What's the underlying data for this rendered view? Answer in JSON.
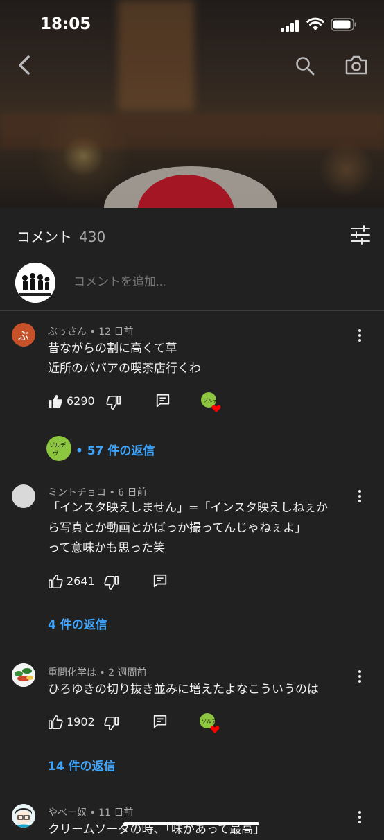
{
  "status": {
    "time": "18:05"
  },
  "comments_header": {
    "title": "コメント",
    "count": "430"
  },
  "add_comment": {
    "placeholder": "コメントを追加..."
  },
  "comments": [
    {
      "author": "ぶぅさん",
      "age": "12 日前",
      "avatar_letter": "ぶ",
      "avatar_color": "#c7522a",
      "lines": [
        "昔ながらの割に高くて草",
        "近所のババアの喫茶店行くわ"
      ],
      "likes": "6290",
      "replies_label": "57 件の返信",
      "replies_prefix": "•"
    },
    {
      "author": "ミントチョコ",
      "age": "6 日前",
      "avatar_color": "#d9d9d9",
      "lines": [
        "「インスタ映えしません」=「インスタ映えしねぇか",
        "ら写真とか動画とかばっか撮ってんじゃねぇよ」",
        "って意味かも思った笑"
      ],
      "likes": "2641",
      "replies_label": "4 件の返信"
    },
    {
      "author": "重問化学は",
      "age": "2 週間前",
      "lines": [
        "ひろゆきの切り抜き並みに増えたよなこういうのは"
      ],
      "likes": "1902",
      "replies_label": "14 件の返信"
    },
    {
      "author": "やべー奴",
      "age": "11 日前",
      "lines": [
        "クリームソーダの時、「味があって最高」"
      ]
    }
  ],
  "colors": {
    "accent_link": "#3ea6ff",
    "panel_bg": "#212121",
    "secondary_text": "#aaaaaa",
    "heart": "#ff0000"
  },
  "icons": [
    "back-icon",
    "search-icon",
    "camera-icon",
    "filter-icon",
    "like-icon",
    "dislike-icon",
    "reply-icon",
    "more-icon",
    "heart-icon"
  ]
}
